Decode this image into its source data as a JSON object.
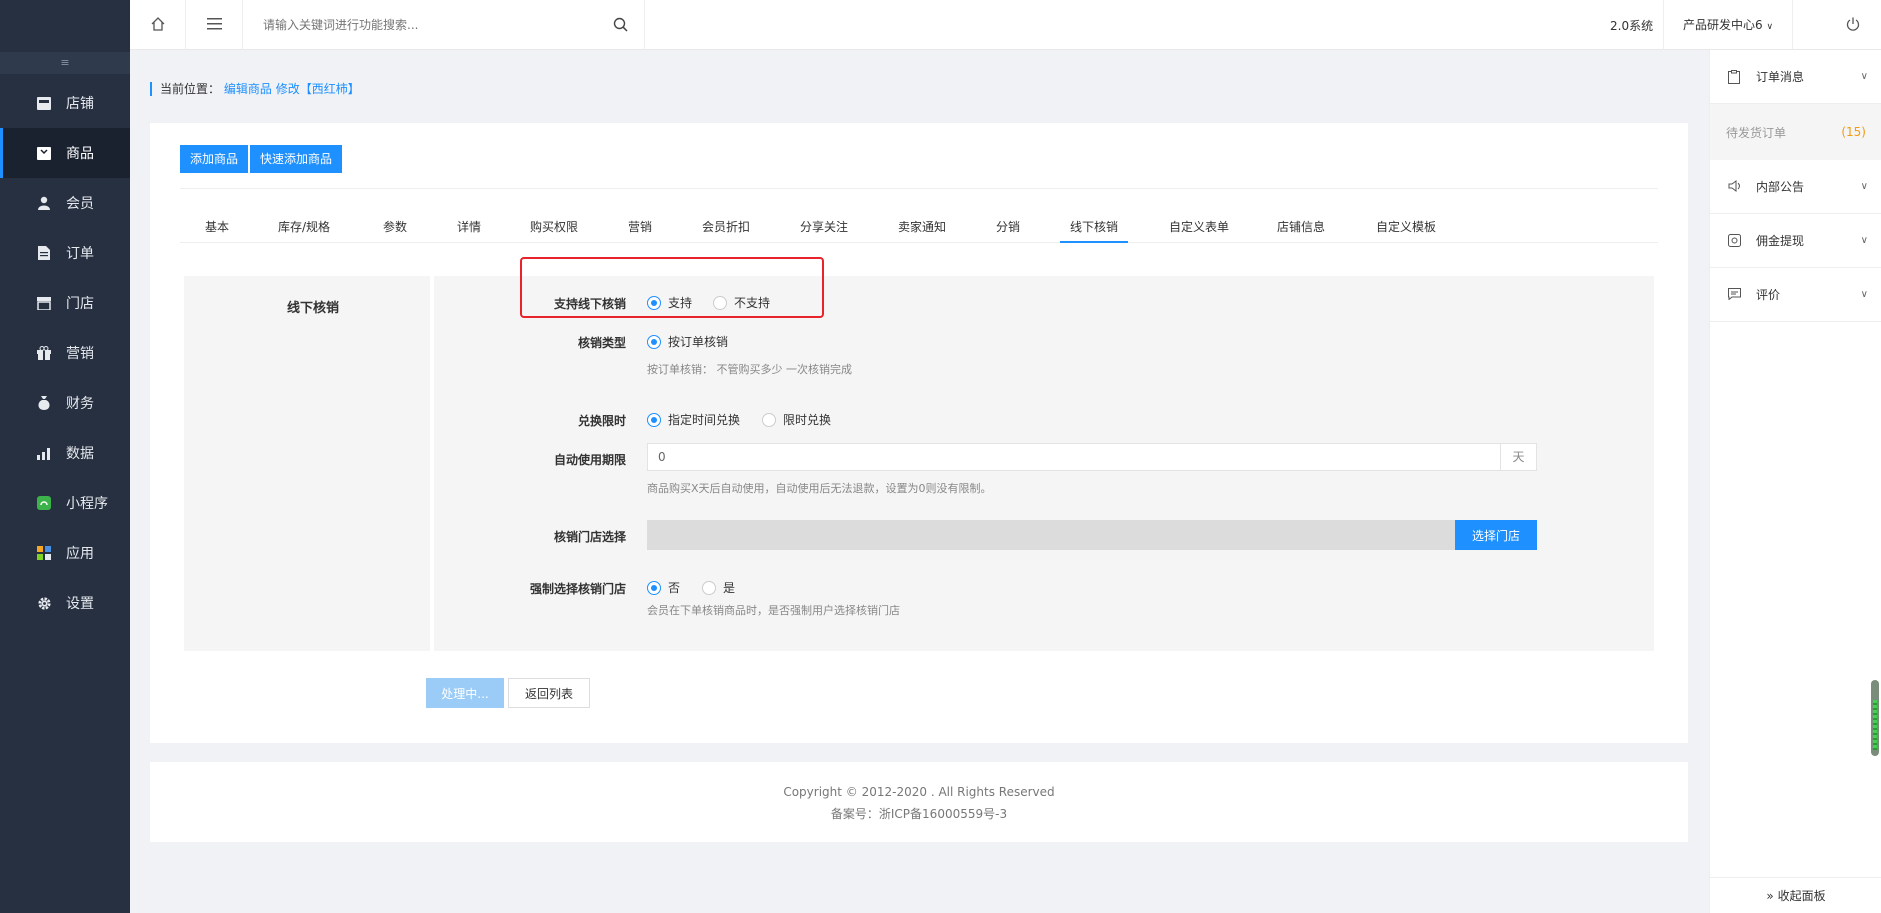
{
  "sidebar": {
    "collapse_glyph": "≡",
    "items": [
      {
        "label": "店铺",
        "icon": "store-icon"
      },
      {
        "label": "商品",
        "icon": "goods-icon"
      },
      {
        "label": "会员",
        "icon": "member-icon"
      },
      {
        "label": "订单",
        "icon": "order-icon"
      },
      {
        "label": "门店",
        "icon": "shop-icon"
      },
      {
        "label": "营销",
        "icon": "gift-icon"
      },
      {
        "label": "财务",
        "icon": "money-bag-icon"
      },
      {
        "label": "数据",
        "icon": "data-chart-icon"
      },
      {
        "label": "小程序",
        "icon": "miniprogram-icon"
      },
      {
        "label": "应用",
        "icon": "apps-icon"
      },
      {
        "label": "设置",
        "icon": "gear-icon"
      }
    ],
    "active_index": 1
  },
  "topbar": {
    "search_placeholder": "请输入关键词进行功能搜索...",
    "system_label": "2.0系统",
    "org_label": "产品研发中心6"
  },
  "breadcrumb": {
    "prefix": "当前位置：",
    "link1": "编辑商品",
    "link2": "修改【西红柿】"
  },
  "toolbar": {
    "add_goods": "添加商品",
    "quick_add_goods": "快速添加商品"
  },
  "tabs": [
    "基本",
    "库存/规格",
    "参数",
    "详情",
    "购买权限",
    "营销",
    "会员折扣",
    "分享关注",
    "卖家通知",
    "分销",
    "线下核销",
    "自定义表单",
    "店铺信息",
    "自定义模板"
  ],
  "active_tab": "线下核销",
  "form": {
    "section_title": "线下核销",
    "support": {
      "label": "支持线下核销",
      "options": [
        "支持",
        "不支持"
      ],
      "selected": "支持"
    },
    "verify_type": {
      "label": "核销类型",
      "options": [
        "按订单核销"
      ],
      "selected": "按订单核销",
      "hint": "按订单核销： 不管购买多少 一次核销完成"
    },
    "exchange_limit": {
      "label": "兑换限时",
      "options": [
        "指定时间兑换",
        "限时兑换"
      ],
      "selected": "指定时间兑换"
    },
    "auto_use": {
      "label": "自动使用期限",
      "value": "0",
      "unit": "天",
      "hint": "商品购买X天后自动使用，自动使用后无法退款，设置为0则没有限制。"
    },
    "store_select": {
      "label": "核销门店选择",
      "button": "选择门店"
    },
    "force_store": {
      "label": "强制选择核销门店",
      "options": [
        "否",
        "是"
      ],
      "selected": "否",
      "hint": "会员在下单核销商品时，是否强制用户选择核销门店"
    }
  },
  "actions": {
    "processing": "处理中...",
    "back": "返回列表"
  },
  "footer": {
    "copyright": "Copyright © 2012-2020 . All Rights Reserved",
    "icp": "备案号：浙ICP备16000559号-3"
  },
  "right_panel": {
    "items": [
      {
        "label": "订单消息",
        "icon": "clipboard-icon"
      },
      {
        "label": "内部公告",
        "icon": "speaker-icon"
      },
      {
        "label": "佣金提现",
        "icon": "withdraw-icon"
      },
      {
        "label": "评价",
        "icon": "comment-icon"
      }
    ],
    "pending_label": "待发货订单",
    "pending_count": "(15)",
    "collapse_label": "» 收起面板"
  },
  "colors": {
    "accent": "#1e90ff",
    "sidebar_bg": "#263040",
    "highlight_border": "#e8232b"
  }
}
